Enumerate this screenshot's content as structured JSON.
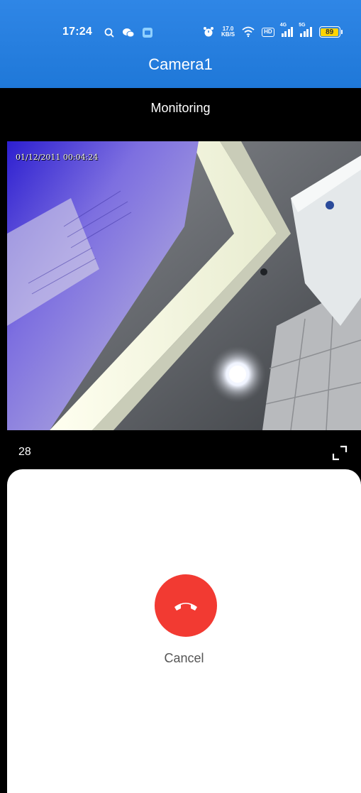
{
  "status_bar": {
    "time": "17:24",
    "net_speed_value": "17.0",
    "net_speed_unit": "KB/S",
    "hd_badge": "HD",
    "sim1_tag": "4G",
    "sim2_tag": "5G",
    "battery_level": "89",
    "left_icons": [
      "search-icon",
      "wechat-icon",
      "app-notification-icon"
    ],
    "right_icons": [
      "alarm-icon",
      "wifi-icon",
      "hd-icon",
      "signal-4g-icon",
      "signal-5g-icon",
      "battery-icon"
    ]
  },
  "header": {
    "title": "Camera1"
  },
  "monitor": {
    "label": "Monitoring"
  },
  "video": {
    "timestamp": "01/12/2011 00:04:24",
    "counter": "28",
    "fullscreen_icon": "fullscreen-icon"
  },
  "call": {
    "cancel_label": "Cancel",
    "hangup_icon": "phone-hangup-icon",
    "hangup_color": "#f23a32"
  },
  "colors": {
    "header_blue": "#2f86e6",
    "accent_red": "#f23a32"
  }
}
